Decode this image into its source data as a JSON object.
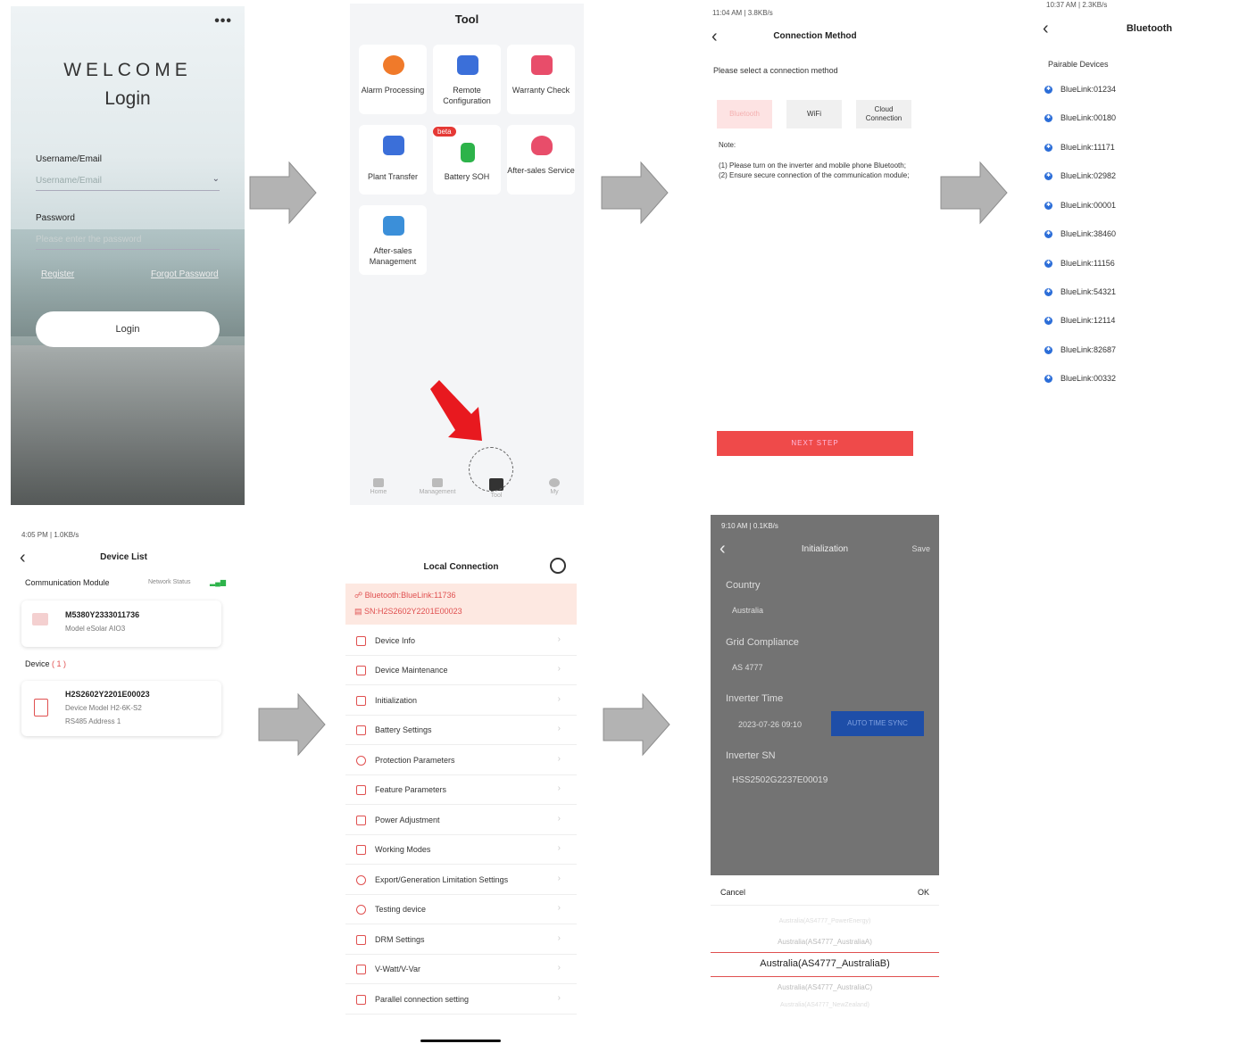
{
  "login": {
    "menu": "•••",
    "welcome": "WELCOME",
    "title": "Login",
    "username_label": "Username/Email",
    "username_placeholder": "Username/Email",
    "password_label": "Password",
    "password_placeholder": "Please enter the password",
    "register": "Register",
    "forgot": "Forgot Password",
    "login_button": "Login"
  },
  "tool": {
    "title": "Tool",
    "cards": [
      {
        "label": "Alarm Processing",
        "icon": "alarm-icon",
        "color": "#f07a2a"
      },
      {
        "label": "Remote Configuration",
        "icon": "remote-config-icon",
        "color": "#3b6fd9"
      },
      {
        "label": "Warranty Check",
        "icon": "warranty-icon",
        "color": "#e84d6a"
      },
      {
        "label": "Plant Transfer",
        "icon": "plant-transfer-icon",
        "color": "#3b6fd9"
      },
      {
        "label": "Battery SOH",
        "icon": "battery-icon",
        "color": "#2db34a",
        "badge": "beta"
      },
      {
        "label": "After-sales Service",
        "icon": "after-sales-service-icon",
        "color": "#e84d6a"
      },
      {
        "label": "After-sales Management",
        "icon": "after-sales-management-icon",
        "color": "#3b8fd9"
      }
    ],
    "tabs": [
      "Home",
      "Management",
      "Tool",
      "My"
    ]
  },
  "connection": {
    "status": "11:04 AM | 3.8KB/s",
    "title": "Connection Method",
    "prompt": "Please select a connection method",
    "options": [
      "Bluetooth",
      "WiFi",
      "Cloud Connection"
    ],
    "note_title": "Note:",
    "note1": "(1) Please turn on the inverter and mobile phone Bluetooth;",
    "note2": "(2) Ensure secure connection of the communication module;",
    "next": "NEXT STEP"
  },
  "bluetooth": {
    "status": "10:37 AM | 2.3KB/s",
    "title": "Bluetooth",
    "section": "Pairable Devices",
    "devices": [
      "BlueLink:01234",
      "BlueLink:00180",
      "BlueLink:11171",
      "BlueLink:02982",
      "BlueLink:00001",
      "BlueLink:38460",
      "BlueLink:11156",
      "BlueLink:54321",
      "BlueLink:12114",
      "BlueLink:82687",
      "BlueLink:00332"
    ]
  },
  "devices": {
    "status": "4:05 PM | 1.0KB/s",
    "title": "Device List",
    "module_section": "Communication Module",
    "network_status": "Network Status",
    "module_sn": "M5380Y2333011736",
    "module_model": "Model  eSolar AIO3",
    "device_section": "Device",
    "device_count": "( 1 )",
    "device_sn": "H2S2602Y2201E00023",
    "device_model": "Device Model  H2-6K-S2",
    "device_rs485": "RS485 Address  1"
  },
  "local": {
    "title": "Local Connection",
    "bt_line": "Bluetooth:BlueLink:11736",
    "sn_line": "SN:H2S2602Y2201E00023",
    "items": [
      "Device Info",
      "Device Maintenance",
      "Initialization",
      "Battery Settings",
      "Protection Parameters",
      "Feature Parameters",
      "Power Adjustment",
      "Working Modes",
      "Export/Generation Limitation Settings",
      "Testing device",
      "DRM Settings",
      "V-Watt/V-Var",
      "Parallel connection setting"
    ]
  },
  "init": {
    "status": "9:10 AM | 0.1KB/s",
    "title": "Initialization",
    "save": "Save",
    "country_label": "Country",
    "country_value": "Australia",
    "grid_label": "Grid Compliance",
    "grid_value": "AS 4777",
    "time_label": "Inverter Time",
    "time_value": "2023-07-26 09:10",
    "sync_button": "AUTO TIME SYNC",
    "sn_label": "Inverter SN",
    "sn_value": "HSS2502G2237E00019",
    "cancel": "Cancel",
    "ok": "OK",
    "options": [
      "Australia(AS4777_PowerEnergy)",
      "Australia(AS4777_AustraliaA)",
      "Australia(AS4777_AustraliaB)",
      "Australia(AS4777_AustraliaC)",
      "Australia(AS4777_NewZealand)"
    ]
  }
}
